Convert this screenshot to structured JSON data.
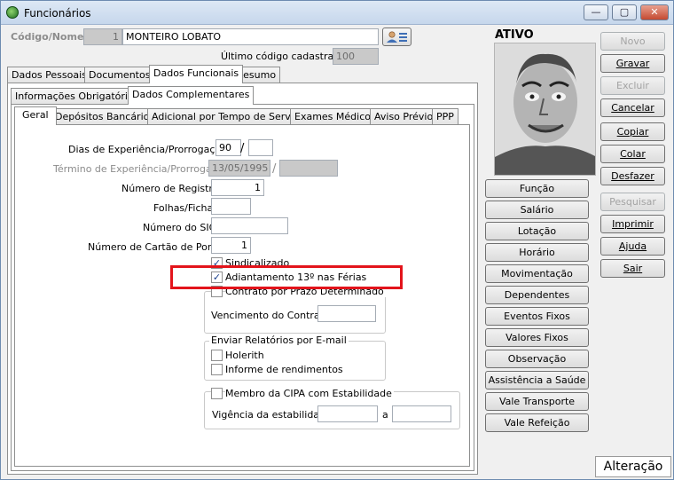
{
  "window": {
    "title": "Funcionários",
    "minimize_label": "—",
    "restore_label": "▢",
    "close_label": "✕"
  },
  "header": {
    "code_name_label": "Código/Nome",
    "code_value": "1",
    "name_value": "MONTEIRO LOBATO",
    "last_code_label": "Último código cadastrado:",
    "last_code_value": "100",
    "status_title": "ATIVO"
  },
  "main_tabs": [
    "Dados Pessoais",
    "Documentos",
    "Dados Funcionais",
    "Resumo"
  ],
  "sub_tabs": [
    "Informações Obrigatórias",
    "Dados Complementares"
  ],
  "inner_tabs": [
    "Geral",
    "Depósitos Bancários",
    "Adicional por Tempo de Serviço",
    "Exames Médicos",
    "Aviso Prévio",
    "PPP"
  ],
  "form": {
    "experience_label": "Dias de Experiência/Prorrogação",
    "experience_days": "90",
    "experience_extension": "",
    "slash": "/",
    "end_experience_label": "Término de Experiência/Prorrogação",
    "end_experience_date": "13/05/1995",
    "end_experience_ext": "",
    "registration_label": "Número de Registro",
    "registration_value": "1",
    "sheet_label": "Folhas/Ficha",
    "sheet_value": "",
    "sic_label": "Número do SIC",
    "sic_value": "",
    "card_label": "Número de Cartão de Ponto",
    "card_value": "1",
    "unionized_label": "Sindicalizado",
    "advance_label": "Adiantamento 13º nas Férias",
    "fixed_term_label": "Contrato por Prazo Determinado",
    "contract_expiry_label": "Vencimento do Contrato",
    "contract_expiry_value": "",
    "email_reports_label": "Enviar Relatórios por E-mail",
    "payslip_label": "Holerith",
    "income_report_label": "Informe de rendimentos",
    "cipa_label": "Membro da CIPA com Estabilidade",
    "stability_label": "Vigência da estabilidade",
    "stability_from": "",
    "and_label": "a",
    "stability_to": ""
  },
  "side_buttons": [
    "Função",
    "Salário",
    "Lotação",
    "Horário",
    "Movimentação",
    "Dependentes",
    "Eventos Fixos",
    "Valores Fixos",
    "Observação",
    "Assistência a Saúde",
    "Vale Transporte",
    "Vale Refeição"
  ],
  "action_buttons": {
    "novo": "Novo",
    "gravar": "Gravar",
    "excluir": "Excluir",
    "cancelar": "Cancelar",
    "copiar": "Copiar",
    "colar": "Colar",
    "desfazer": "Desfazer",
    "pesquisar": "Pesquisar",
    "imprimir": "Imprimir",
    "ajuda": "Ajuda",
    "sair": "Sair"
  },
  "status_bar": "Alteração",
  "icons": {
    "app": "app-globe-icon",
    "lookup": "person-card-icon",
    "check": "checkmark-icon"
  }
}
